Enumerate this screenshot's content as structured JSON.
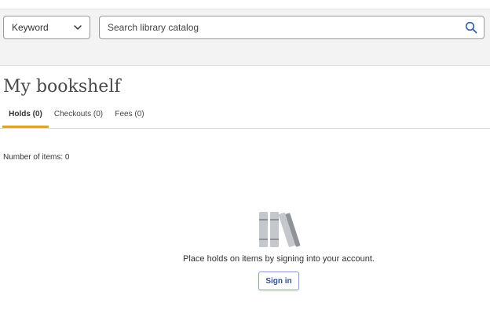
{
  "search": {
    "type_label": "Keyword",
    "placeholder": "Search library catalog"
  },
  "page": {
    "title": "My bookshelf"
  },
  "tabs": [
    {
      "label": "Holds (0)",
      "active": true
    },
    {
      "label": "Checkouts (0)",
      "active": false
    },
    {
      "label": "Fees (0)",
      "active": false
    }
  ],
  "content": {
    "item_count": "Number of items: 0",
    "empty_message": "Place holds on items by signing into your account.",
    "sign_in_label": "Sign in"
  },
  "colors": {
    "accent": "#d9a43a",
    "link": "#2f4f8f",
    "search_icon": "#2f5fa6",
    "illustration": "#b9bcc0"
  },
  "icons": {
    "dropdown": "chevron-down-icon",
    "search": "search-icon",
    "empty_state": "books-icon"
  }
}
